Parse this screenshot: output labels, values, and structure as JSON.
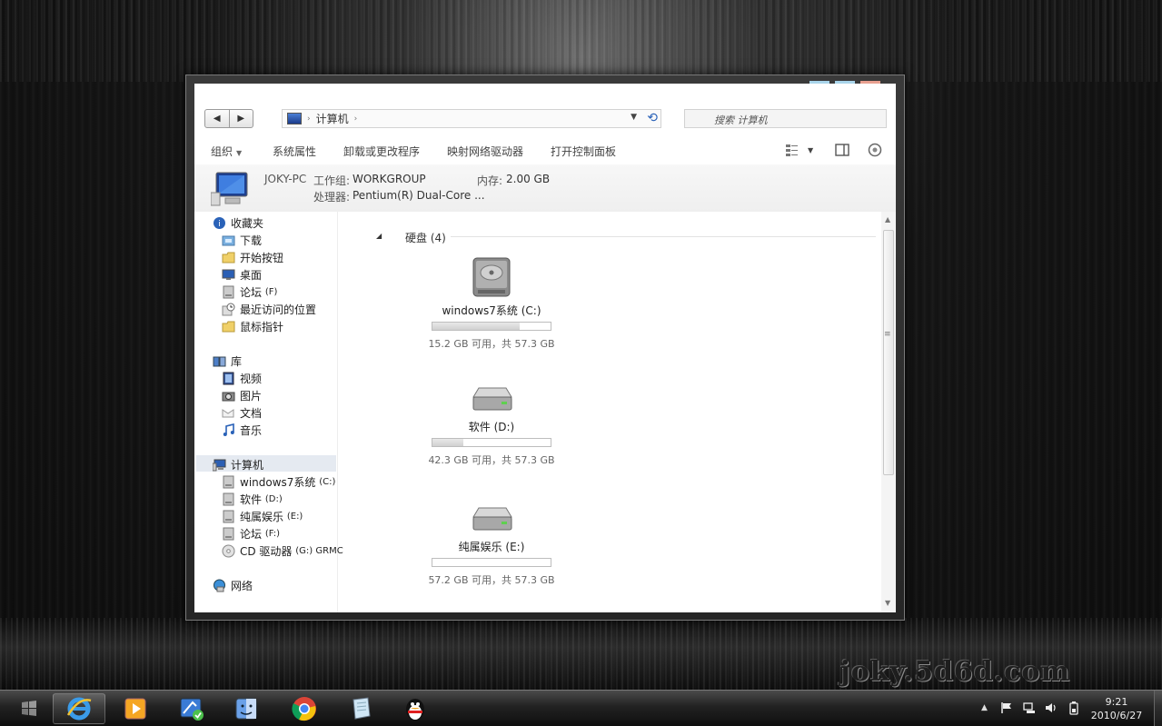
{
  "watermark": "joky.5d6d.com",
  "window": {
    "address": {
      "path": "计算机",
      "icon": "computer-icon"
    },
    "search_placeholder": "搜索 计算机",
    "commands": {
      "organize": "组织",
      "system_properties": "系统属性",
      "uninstall": "卸载或更改程序",
      "map_drive": "映射网络驱动器",
      "control_panel": "打开控制面板"
    },
    "details": {
      "pc_name": "JOKY-PC",
      "workgroup_label": "工作组:",
      "workgroup_value": "WORKGROUP",
      "memory_label": "内存:",
      "memory_value": "2.00 GB",
      "cpu_label": "处理器:",
      "cpu_value": "Pentium(R) Dual-Core ..."
    },
    "sidebar": {
      "favorites": {
        "label": "收藏夹",
        "items": [
          "下载",
          "开始按钮",
          "桌面",
          "论坛",
          "最近访问的位置",
          "鼠标指针"
        ],
        "forum_drive": "(F)"
      },
      "library": {
        "label": "库",
        "items": [
          "视频",
          "图片",
          "文档",
          "音乐"
        ]
      },
      "computer": {
        "label": "计算机",
        "items": [
          {
            "name": "windows7系统",
            "drive": "(C:)"
          },
          {
            "name": "软件",
            "drive": "(D:)"
          },
          {
            "name": "纯属娱乐",
            "drive": "(E:)"
          },
          {
            "name": "论坛",
            "drive": "(F:)"
          },
          {
            "name": "CD 驱动器",
            "drive": "(G:) GRMC"
          }
        ]
      },
      "network": {
        "label": "网络"
      }
    },
    "content": {
      "group_title": "硬盘 (4)",
      "drives": [
        {
          "label": "windows7系统 (C:)",
          "free": "15.2 GB 可用，共 57.3 GB",
          "used_fraction": 0.735
        },
        {
          "label": "软件 (D:)",
          "free": "42.3 GB 可用，共 57.3 GB",
          "used_fraction": 0.262
        },
        {
          "label": "纯属娱乐 (E:)",
          "free": "57.2 GB 可用，共 57.3 GB",
          "used_fraction": 0.002
        }
      ]
    }
  },
  "taskbar": {
    "clock_time": "9:21",
    "clock_date": "2010/6/27"
  },
  "colors": {
    "accent": "#2a62b8",
    "selection": "#e5eaf1",
    "caption_min": "#a8d4ea",
    "caption_max": "#a8d4ea",
    "caption_close": "#e8a090"
  }
}
